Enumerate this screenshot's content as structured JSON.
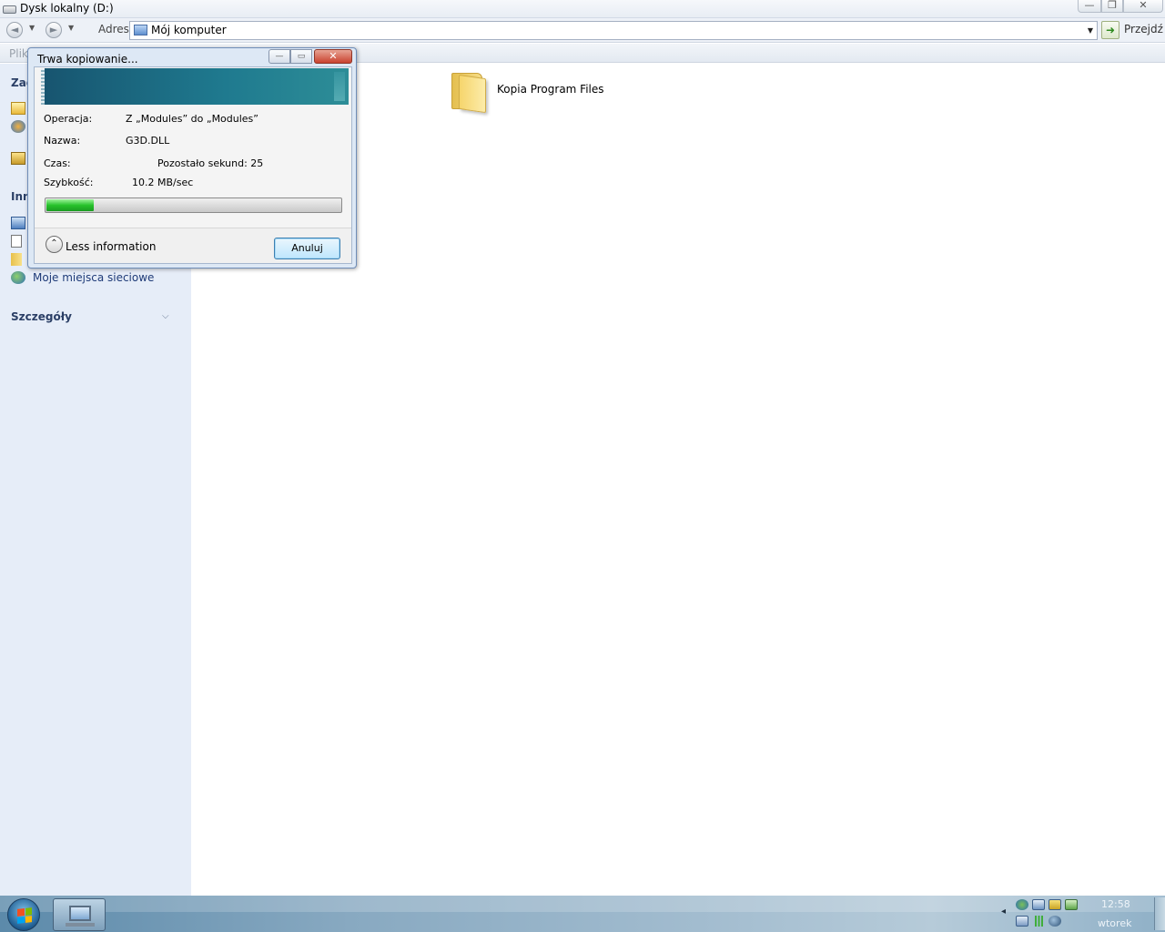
{
  "window": {
    "title": "Dysk lokalny (D:)",
    "controls": {
      "minimize": "—",
      "maximize": "❐",
      "close": "✕"
    }
  },
  "address_bar": {
    "back_icon": "◄",
    "forward_icon": "►",
    "dropdown_icon": "▼",
    "label": "Adres",
    "value": "Mój komputer",
    "go_icon": "➜",
    "go_label": "Przejdź"
  },
  "menu": {
    "first_item": "Plik"
  },
  "task_pane": {
    "section1": "Zad",
    "section2": "Inn",
    "network_link": "Moje miejsca sieciowe",
    "details": "Szczegóły",
    "details_chevron": "⌵"
  },
  "content": {
    "folder_label": "Kopia Program Files"
  },
  "copy_dialog": {
    "title": "Trwa kopiowanie...",
    "controls": {
      "minimize": "—",
      "maximize": "▭",
      "close": "✕"
    },
    "operation_label": "Operacja:",
    "operation_value": "Z „Modules” do „Modules”",
    "name_label": "Nazwa:",
    "name_value": "G3D.DLL",
    "time_label": "Czas:",
    "time_value": "Pozostało sekund: 25",
    "speed_label": "Szybkość:",
    "speed_value": "10.2 MB/sec",
    "progress_fraction": 0.16,
    "expander_icon": "⌃",
    "less_info": "Less information",
    "cancel": "Anuluj"
  },
  "taskbar": {
    "tray_chevron": "◂",
    "time": "12:58",
    "day": "wtorek"
  },
  "colors": {
    "task_pane_bg": "#e6edf8",
    "link": "#1f3b78",
    "progress_green": "#27c22b",
    "dialog_frame": "#dde8f5"
  }
}
